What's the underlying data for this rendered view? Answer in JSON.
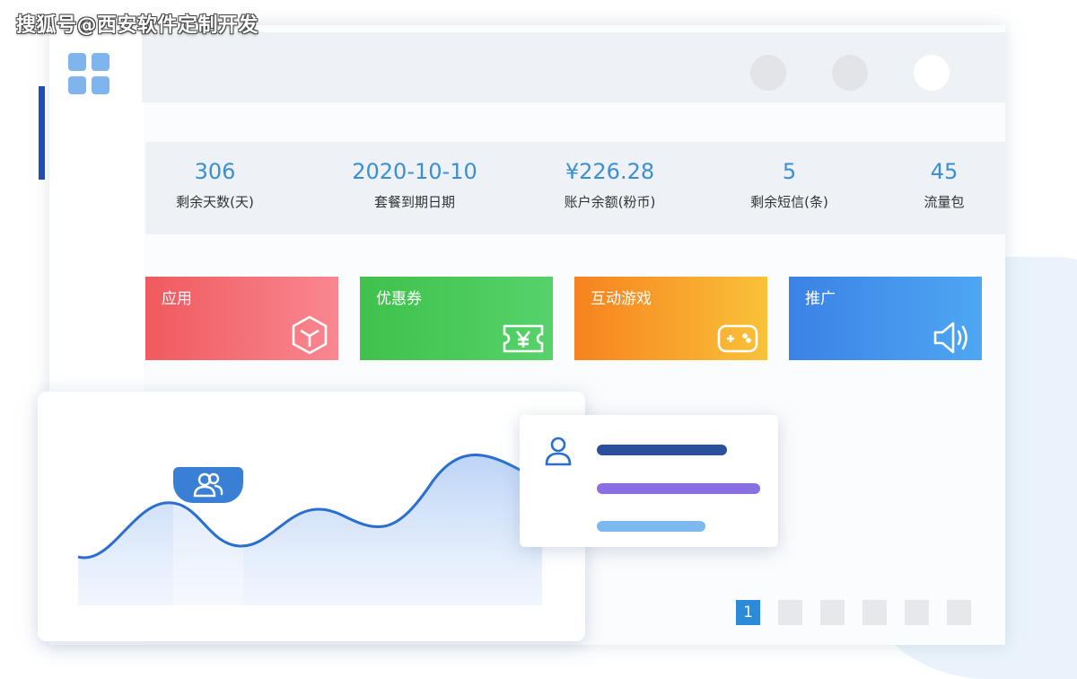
{
  "watermark": "搜狐号@西安软件定制开发",
  "app": {
    "logo_icon": "grid-apps-icon"
  },
  "topbar": {
    "buttons": [
      {
        "icon": "avatar-circle-icon",
        "color": "#e2e4e7"
      },
      {
        "icon": "notification-circle-icon",
        "color": "#e2e4e7"
      },
      {
        "icon": "settings-circle-icon",
        "color": "#ffffff"
      }
    ]
  },
  "stats": [
    {
      "value": "306",
      "label": "剩余天数(天)"
    },
    {
      "value": "2020-10-10",
      "label": "套餐到期日期"
    },
    {
      "value": "¥226.28",
      "label": "账户余额(粉币)"
    },
    {
      "value": "5",
      "label": "剩余短信(条)"
    },
    {
      "value": "45",
      "label": "流量包"
    }
  ],
  "tiles": [
    {
      "label": "应用",
      "icon": "cube-icon",
      "colors": [
        "#f05a5e",
        "#f98791"
      ]
    },
    {
      "label": "优惠券",
      "icon": "ticket-yen-icon",
      "colors": [
        "#3fc24c",
        "#56d26a"
      ]
    },
    {
      "label": "互动游戏",
      "icon": "gamepad-icon",
      "colors": [
        "#f7821f",
        "#f9c238"
      ]
    },
    {
      "label": "推广",
      "icon": "speaker-icon",
      "colors": [
        "#3b82e6",
        "#4ea7f3"
      ]
    }
  ],
  "pagination": {
    "current": "1",
    "pages": [
      "1",
      "",
      "",
      "",
      "",
      ""
    ]
  },
  "chart": {
    "badge_icon": "users-icon",
    "line_color": "#2a6ecf",
    "fill_color": "#c9dcf8"
  },
  "user_card": {
    "icon": "user-icon",
    "bar_colors": [
      "#2a4f9d",
      "#8a6fe0",
      "#7db8ef"
    ]
  }
}
